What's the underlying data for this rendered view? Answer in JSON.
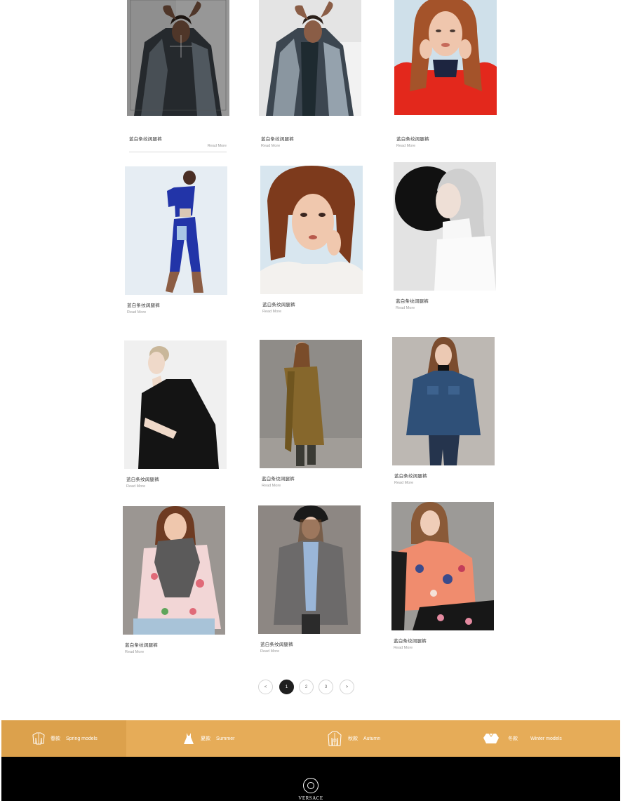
{
  "products": [
    {
      "title": "蓝白条纹阔腿裤",
      "more": "Read More",
      "photo": "model-in-knit-cardigan-photo"
    },
    {
      "title": "蓝白条纹阔腿裤",
      "more": "Read More",
      "photo": "model-in-knit-cardigan-photo"
    },
    {
      "title": "蓝白条纹阔腿裤",
      "more": "Read More",
      "photo": "red-hair-model-photo"
    },
    {
      "title": "蓝白条纹阔腿裤",
      "more": "Read More",
      "photo": "blue-suit-model-photo"
    },
    {
      "title": "蓝白条纹阔腿裤",
      "more": "Read More",
      "photo": "lace-top-model-photo"
    },
    {
      "title": "蓝白条纹阔腿裤",
      "more": "Read More",
      "photo": "white-turtleneck-model-photo"
    },
    {
      "title": "蓝白条纹阔腿裤",
      "more": "Read More",
      "photo": "black-coat-model-photo"
    },
    {
      "title": "蓝白条纹阔腿裤",
      "more": "Read More",
      "photo": "trench-coat-model-photo"
    },
    {
      "title": "蓝白条纹阔腿裤",
      "more": "Read More",
      "photo": "denim-jacket-model-photo"
    },
    {
      "title": "蓝白条纹阔腿裤",
      "more": "Read More",
      "photo": "floral-dress-model-photo"
    },
    {
      "title": "蓝白条纹阔腿裤",
      "more": "Read More",
      "photo": "plaid-blazer-model-photo"
    },
    {
      "title": "蓝白条纹阔腿裤",
      "more": "Read More",
      "photo": "floral-jacket-model-photo"
    }
  ],
  "pagination": {
    "prev": "<",
    "pages": [
      "1",
      "2",
      "3"
    ],
    "current": "1",
    "next": ">"
  },
  "seasons": [
    {
      "cn": "春款",
      "en": "Spring models",
      "icon": "jacket-icon",
      "active": true
    },
    {
      "cn": "夏款",
      "en": "Summer",
      "icon": "dress-icon",
      "active": false
    },
    {
      "cn": "秋款",
      "en": "Autumn",
      "icon": "coat-icon",
      "active": false
    },
    {
      "cn": "冬款",
      "en": "Winter models",
      "icon": "sweater-icon",
      "active": false
    }
  ],
  "footer": {
    "brand": "VERSACE"
  },
  "colors": {
    "season_bar": "#e6ac58",
    "season_active": "#dca14c",
    "footer": "#000000",
    "pagination_active": "#1f1f1f"
  }
}
